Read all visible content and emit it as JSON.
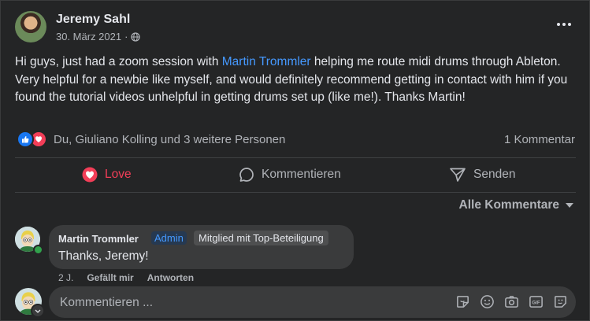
{
  "post": {
    "author": "Jeremy Sahl",
    "date": "30. März 2021",
    "separator": "·",
    "text_parts": [
      "Hi guys, just had a zoom session with ",
      "Martin Trommler",
      " helping me route midi drums through Ableton. Very helpful for a newbie like myself, and would definitely recommend getting in contact with him if you found the tutorial videos unhelpful in getting drums set up (like me!). Thanks Martin!"
    ],
    "reactions_text": "Du, Giuliano Kolling und 3 weitere Personen",
    "comment_count": "1 Kommentar"
  },
  "actions": {
    "love": "Love",
    "comment": "Kommentieren",
    "share": "Senden"
  },
  "comments_filter": "Alle Kommentare",
  "comment": {
    "author": "Martin Trommler",
    "badge_admin": "Admin",
    "badge_top": "Mitglied mit Top-Beteiligung",
    "text": "Thanks, Jeremy!",
    "age": "2 J.",
    "like": "Gefällt mir",
    "reply": "Antworten"
  },
  "composer": {
    "placeholder": "Kommentieren ...",
    "tools": [
      "sticker-icon",
      "emoji-icon",
      "camera-icon",
      "gif-icon",
      "avatar-sticker-icon"
    ]
  },
  "colors": {
    "background": "#242526",
    "text": "#e4e6eb",
    "secondary": "#b0b3b8",
    "link": "#4599ff",
    "love": "#f33e58",
    "like": "#1877f2"
  }
}
